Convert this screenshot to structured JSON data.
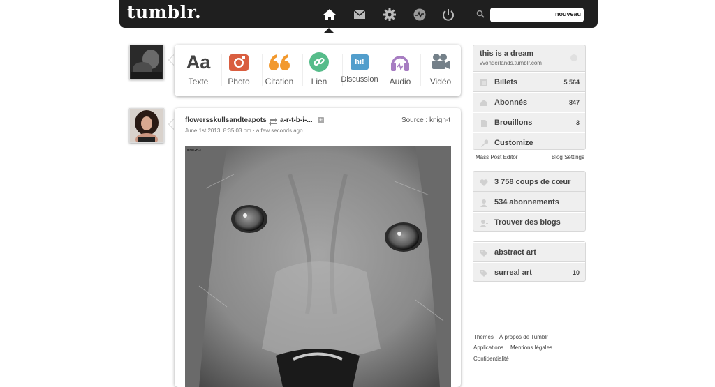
{
  "header": {
    "logo": "tumblr.",
    "nav": [
      "home-icon",
      "mail-icon",
      "gear-icon",
      "activity-icon",
      "power-icon"
    ],
    "search": {
      "placeholder": "",
      "button": "nouveau"
    }
  },
  "composer": {
    "types": [
      {
        "label": "Texte",
        "icon": "text-icon",
        "glyph": "Aa",
        "color": "#444444"
      },
      {
        "label": "Photo",
        "icon": "camera-icon",
        "color": "#d95e40"
      },
      {
        "label": "Citation",
        "icon": "quote-icon",
        "color": "#f2992e"
      },
      {
        "label": "Lien",
        "icon": "link-icon",
        "color": "#56bc8a"
      },
      {
        "label": "Discussion",
        "icon": "chat-icon",
        "glyph": "hi!",
        "color": "#529ecc"
      },
      {
        "label": "Audio",
        "icon": "headphones-icon",
        "color": "#a77dc2"
      },
      {
        "label": "Vidéo",
        "icon": "video-camera-icon",
        "color": "#748089"
      }
    ]
  },
  "post": {
    "author": "flowersskullsandteapots",
    "reblogged_from": "a-r-t-b-i-...",
    "source": "Source : knigh-t",
    "date": "June 1st 2013, 8:35:03 pm · a few seconds ago",
    "watermark": "KNIGH-T"
  },
  "sidebar": {
    "blog": {
      "title": "this is a dream",
      "url": "vvonderlands.tumblr.com",
      "rows": [
        {
          "label": "Billets",
          "count": "5 564",
          "icon": "posts-icon"
        },
        {
          "label": "Abonnés",
          "count": "847",
          "icon": "followers-icon"
        },
        {
          "label": "Brouillons",
          "count": "3",
          "icon": "drafts-icon"
        },
        {
          "label": "Customize",
          "count": "",
          "icon": "wrench-icon"
        }
      ]
    },
    "blog_links": {
      "mass_post_editor": "Mass Post Editor",
      "blog_settings": "Blog Settings"
    },
    "activity": [
      {
        "label": "3 758 coups de cœur",
        "icon": "heart-icon"
      },
      {
        "label": "534 abonnements",
        "icon": "user-icon"
      },
      {
        "label": "Trouver des blogs",
        "icon": "find-user-icon"
      }
    ],
    "tags": [
      {
        "label": "abstract art",
        "count": "",
        "icon": "tag-icon"
      },
      {
        "label": "surreal art",
        "count": "10",
        "icon": "tag-icon"
      }
    ]
  },
  "footer": {
    "links": [
      "Thèmes",
      "À propos de Tumblr",
      "Applications",
      "Mentions légales",
      "Confidentialité"
    ]
  },
  "colors": {
    "topbar": "#1f1f1f",
    "panel": "#efefef",
    "text": "#444444"
  }
}
